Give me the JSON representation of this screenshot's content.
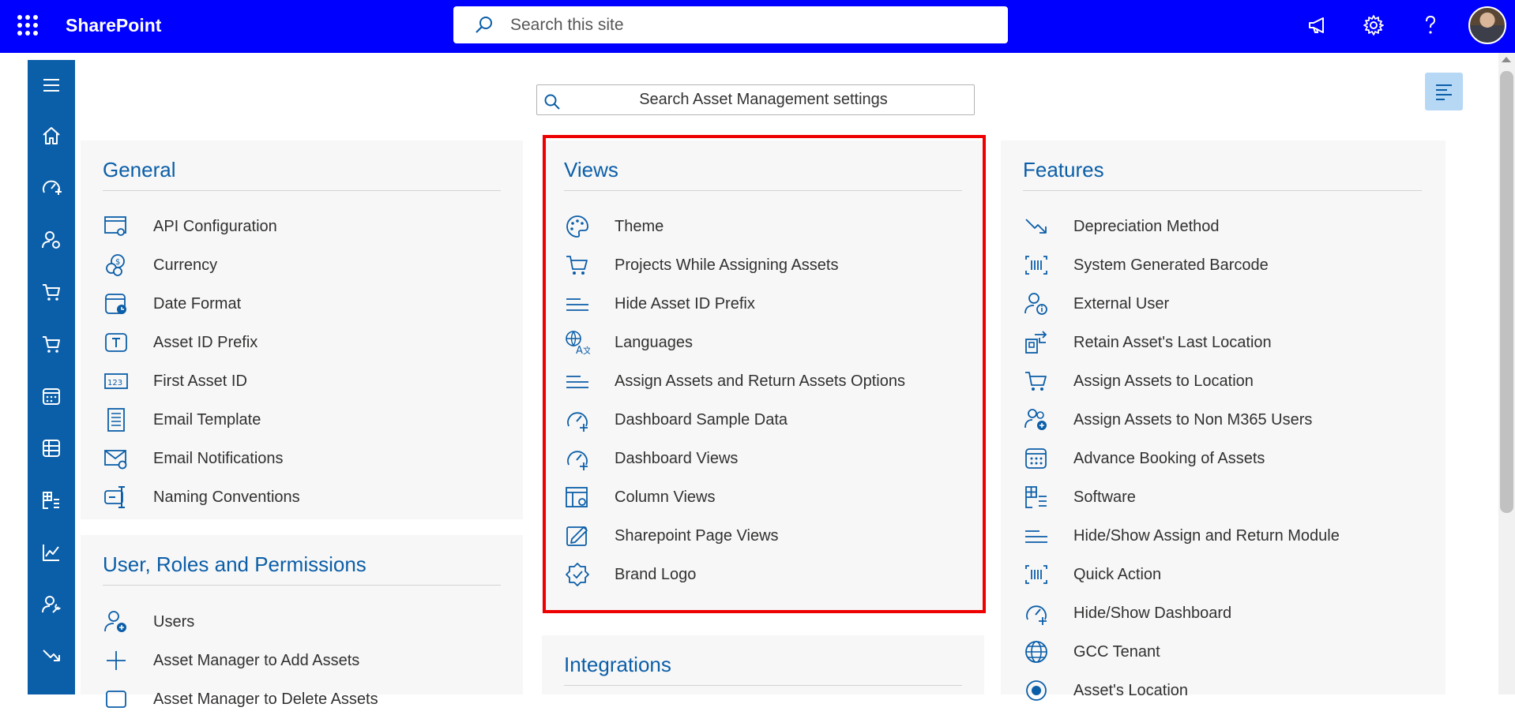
{
  "topbar": {
    "brand": "SharePoint",
    "search_placeholder": "Search this site"
  },
  "settings": {
    "search_placeholder": "Search Asset Management settings"
  },
  "panels": {
    "general": {
      "title": "General",
      "items": [
        {
          "label": "API Configuration",
          "icon": "api-config-icon"
        },
        {
          "label": "Currency",
          "icon": "currency-icon"
        },
        {
          "label": "Date Format",
          "icon": "date-format-icon"
        },
        {
          "label": "Asset ID Prefix",
          "icon": "text-prefix-icon"
        },
        {
          "label": "First Asset ID",
          "icon": "number-icon"
        },
        {
          "label": "Email Template",
          "icon": "document-icon"
        },
        {
          "label": "Email Notifications",
          "icon": "mail-settings-icon"
        },
        {
          "label": "Naming Conventions",
          "icon": "rename-icon"
        }
      ]
    },
    "users": {
      "title": "User, Roles and Permissions",
      "items": [
        {
          "label": "Users",
          "icon": "person-add-icon"
        },
        {
          "label": "Asset Manager to Add Assets",
          "icon": "plus-icon"
        },
        {
          "label": "Asset Manager to Delete Assets",
          "icon": "delete-icon"
        }
      ]
    },
    "views": {
      "title": "Views",
      "items": [
        {
          "label": "Theme",
          "icon": "palette-icon"
        },
        {
          "label": "Projects While Assigning Assets",
          "icon": "cart-icon"
        },
        {
          "label": "Hide Asset ID Prefix",
          "icon": "short-text-icon"
        },
        {
          "label": "Languages",
          "icon": "translate-icon"
        },
        {
          "label": "Assign Assets and Return Assets Options",
          "icon": "short-text-icon"
        },
        {
          "label": "Dashboard Sample Data",
          "icon": "gauge-add-icon"
        },
        {
          "label": "Dashboard Views",
          "icon": "gauge-add-icon"
        },
        {
          "label": "Column Views",
          "icon": "table-settings-icon"
        },
        {
          "label": "Sharepoint Page Views",
          "icon": "edit-page-icon"
        },
        {
          "label": "Brand Logo",
          "icon": "badge-check-icon"
        }
      ]
    },
    "integrations": {
      "title": "Integrations"
    },
    "features": {
      "title": "Features",
      "items": [
        {
          "label": "Depreciation Method",
          "icon": "trend-down-icon"
        },
        {
          "label": "System Generated Barcode",
          "icon": "barcode-icon"
        },
        {
          "label": "External User",
          "icon": "person-info-icon"
        },
        {
          "label": "Retain Asset's Last Location",
          "icon": "location-transfer-icon"
        },
        {
          "label": "Assign Assets to Location",
          "icon": "cart-icon"
        },
        {
          "label": "Assign Assets to Non M365 Users",
          "icon": "people-add-icon"
        },
        {
          "label": "Advance Booking of Assets",
          "icon": "calendar-icon"
        },
        {
          "label": "Software",
          "icon": "grid-list-icon"
        },
        {
          "label": "Hide/Show Assign and Return Module",
          "icon": "short-text-icon"
        },
        {
          "label": "Quick Action",
          "icon": "barcode-icon"
        },
        {
          "label": "Hide/Show Dashboard",
          "icon": "gauge-add-icon"
        },
        {
          "label": "GCC Tenant",
          "icon": "globe-icon"
        },
        {
          "label": "Asset's Location",
          "icon": "location-icon"
        }
      ]
    }
  },
  "colors": {
    "topbar": "#0000ff",
    "nav": "#0b5ea8",
    "accent": "#0b5ea8",
    "highlight": "#ee0000"
  }
}
